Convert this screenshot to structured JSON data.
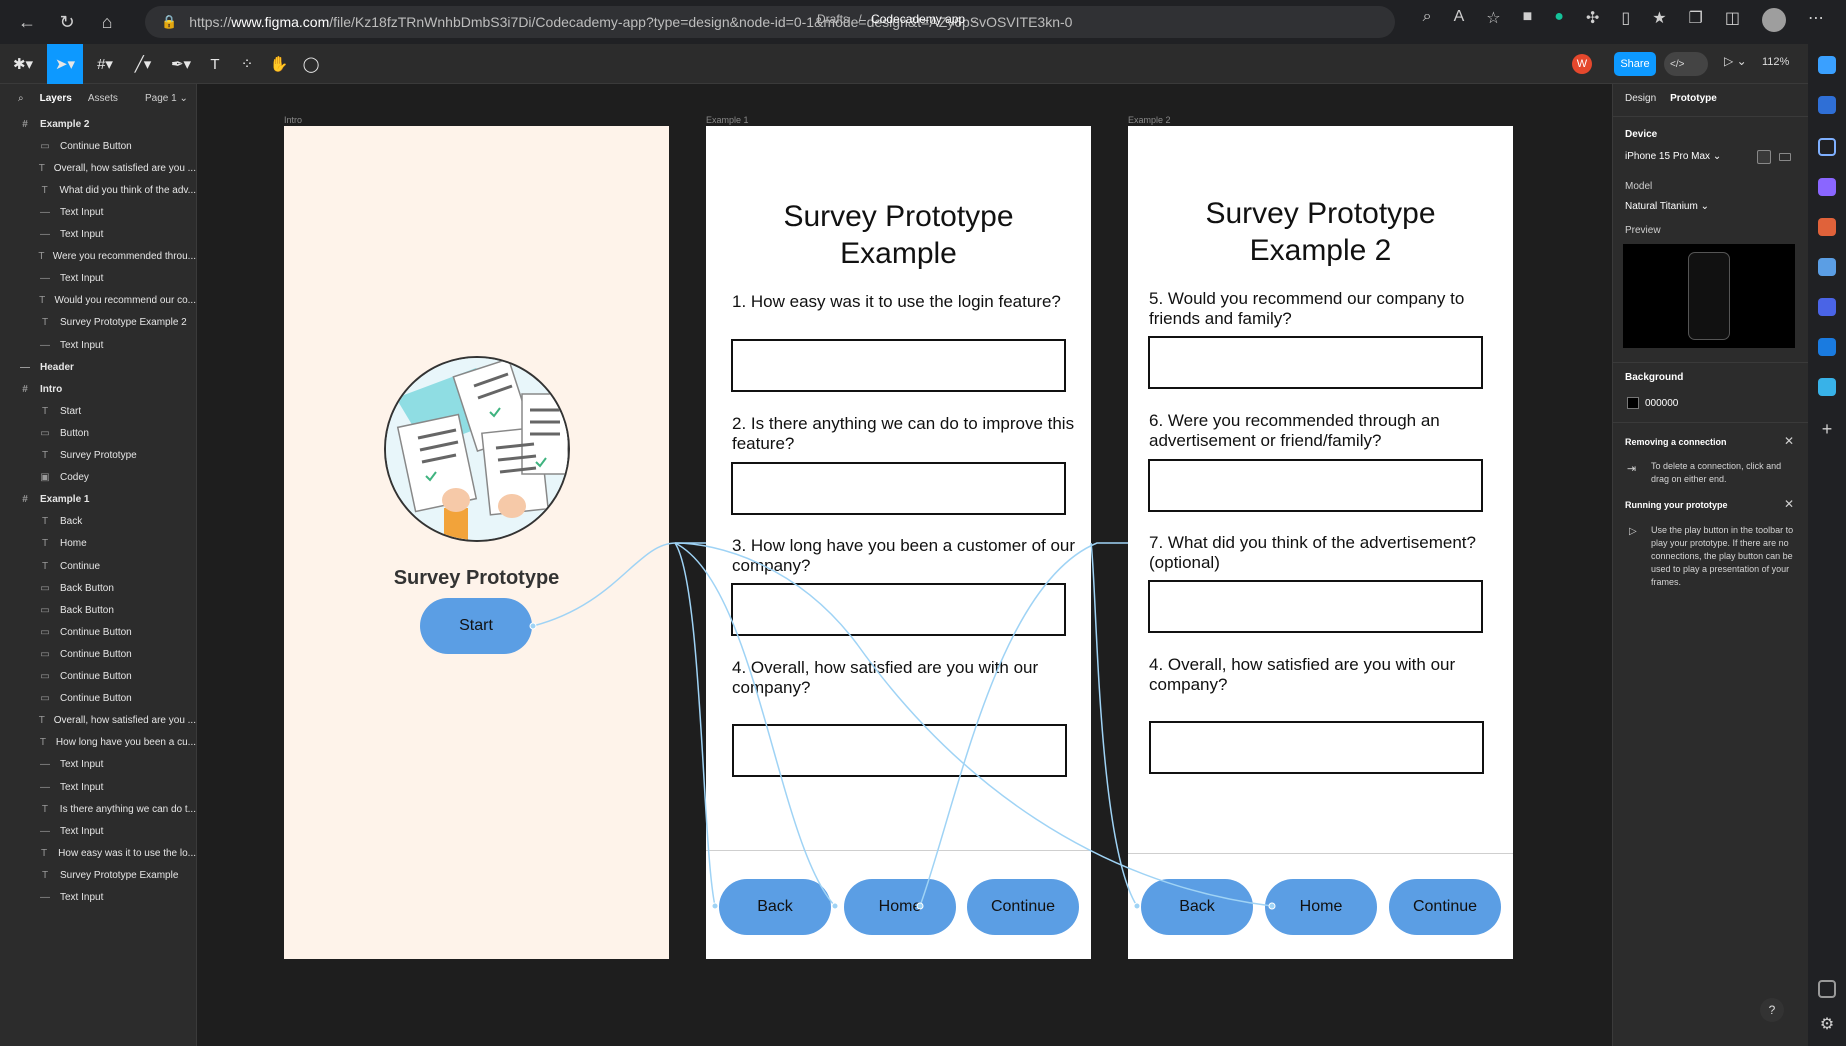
{
  "browser": {
    "url_prefix": "https://",
    "url_host": "www.figma.com",
    "url_path": "/file/Kz18fzTRnWnhbDmbS3i7Di/Codecademy-app?type=design&node-id=0-1&mode=design&t=AZy6pSvOSVITE3kn-0"
  },
  "toolbar": {
    "breadcrumb_root": "Drafts",
    "breadcrumb_sep": "/",
    "file_name": "Codecademy app",
    "share_label": "Share",
    "user_initial": "W",
    "zoom": "112%"
  },
  "layers": {
    "tab_layers": "Layers",
    "tab_assets": "Assets",
    "page": "Page 1",
    "items": [
      {
        "label": "Example 2",
        "icon": "#",
        "frame": true
      },
      {
        "label": "Continue Button",
        "icon": "▭"
      },
      {
        "label": "Overall, how satisfied are you ...",
        "icon": "T"
      },
      {
        "label": "What did you think of the adv...",
        "icon": "T"
      },
      {
        "label": "Text Input",
        "icon": "—"
      },
      {
        "label": "Text Input",
        "icon": "—"
      },
      {
        "label": "Were you recommended throu...",
        "icon": "T"
      },
      {
        "label": "Text Input",
        "icon": "—"
      },
      {
        "label": "Would you recommend our co...",
        "icon": "T"
      },
      {
        "label": "Survey Prototype Example 2",
        "icon": "T"
      },
      {
        "label": "Text Input",
        "icon": "—"
      },
      {
        "label": "Header",
        "icon": "—",
        "frame": true
      },
      {
        "label": "Intro",
        "icon": "#",
        "frame": true
      },
      {
        "label": "Start",
        "icon": "T"
      },
      {
        "label": "Button",
        "icon": "▭"
      },
      {
        "label": "Survey Prototype",
        "icon": "T"
      },
      {
        "label": "Codey",
        "icon": "▣"
      },
      {
        "label": "Example 1",
        "icon": "#",
        "frame": true
      },
      {
        "label": "Back",
        "icon": "T"
      },
      {
        "label": "Home",
        "icon": "T"
      },
      {
        "label": "Continue",
        "icon": "T"
      },
      {
        "label": "Back Button",
        "icon": "▭"
      },
      {
        "label": "Back Button",
        "icon": "▭"
      },
      {
        "label": "Continue Button",
        "icon": "▭"
      },
      {
        "label": "Continue Button",
        "icon": "▭"
      },
      {
        "label": "Continue Button",
        "icon": "▭"
      },
      {
        "label": "Continue Button",
        "icon": "▭"
      },
      {
        "label": "Overall, how satisfied are you ...",
        "icon": "T"
      },
      {
        "label": "How long have you been a cu...",
        "icon": "T"
      },
      {
        "label": "Text Input",
        "icon": "—"
      },
      {
        "label": "Text Input",
        "icon": "—"
      },
      {
        "label": "Is there anything we can do t...",
        "icon": "T"
      },
      {
        "label": "Text Input",
        "icon": "—"
      },
      {
        "label": "How easy was it to use the lo...",
        "icon": "T"
      },
      {
        "label": "Survey Prototype Example",
        "icon": "T"
      },
      {
        "label": "Text Input",
        "icon": "—"
      }
    ]
  },
  "canvas": {
    "intro": {
      "label": "Intro",
      "title": "Survey Prototype",
      "start_label": "Start"
    },
    "example1": {
      "label": "Example 1",
      "title_line1": "Survey Prototype",
      "title_line2": "Example",
      "questions": [
        "1. How easy was it to use the login feature?",
        "2. Is there anything we can do to improve this feature?",
        "3. How long have you been a customer of our company?",
        "4. Overall, how satisfied are you with our company?"
      ],
      "buttons": [
        "Back",
        "Home",
        "Continue"
      ]
    },
    "example2": {
      "label": "Example 2",
      "title_line1": "Survey Prototype",
      "title_line2": "Example 2",
      "questions": [
        "5. Would you recommend our company to friends and family?",
        "6. Were you recommended through an advertisement or friend/family?",
        "7. What did you think of the advertisement? (optional)",
        "4. Overall, how satisfied are you with our company?"
      ],
      "buttons": [
        "Back",
        "Home",
        "Continue"
      ]
    }
  },
  "right_panel": {
    "tab_design": "Design",
    "tab_prototype": "Prototype",
    "device_heading": "Device",
    "device": "iPhone 15 Pro Max",
    "model_heading": "Model",
    "model": "Natural Titanium",
    "preview_heading": "Preview",
    "background_heading": "Background",
    "background_value": "000000",
    "tip1_title": "Removing a connection",
    "tip1_body": "To delete a connection, click and drag on either end.",
    "tip2_title": "Running your prototype",
    "tip2_body": "Use the play button in the toolbar to play your prototype. If there are no connections, the play button can be used to play a presentation of your frames."
  },
  "help": "?",
  "colors": {
    "accent": "#0d99ff",
    "button_fill": "#5b9ee4",
    "connection": "#9fd3f5",
    "intro_bg": "#fef3ea"
  }
}
